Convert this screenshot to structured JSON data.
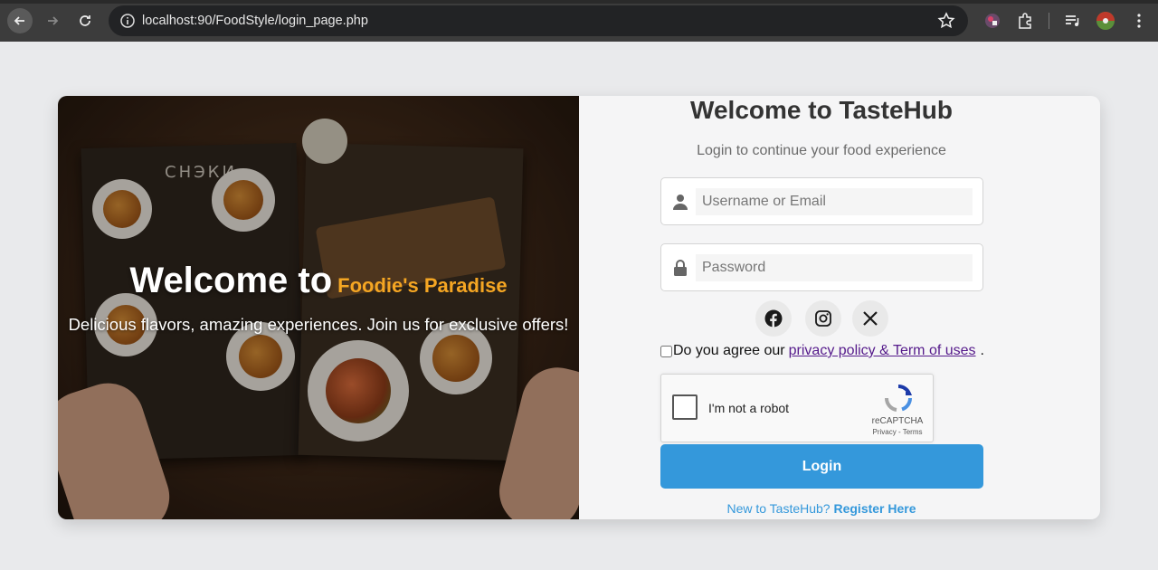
{
  "browser": {
    "url": "localhost:90/FoodStyle/login_page.php"
  },
  "hero": {
    "title_lead": "Welcome to",
    "title_accent": "Foodie's Paradise",
    "subtitle": "Delicious flavors, amazing experiences. Join us for exclusive offers!",
    "menu_heading": "СНЭКИ"
  },
  "form": {
    "title": "Welcome to TasteHub",
    "subtitle": "Login to continue your food experience",
    "username_placeholder": "Username or Email",
    "password_placeholder": "Password",
    "agree_text": "Do you agree our",
    "policy_link": "privacy policy & Term of uses",
    "period": ".",
    "login_label": "Login",
    "register_prompt": "New to TasteHub?",
    "register_link": "Register Here"
  },
  "recaptcha": {
    "label": "I'm not a robot",
    "brand": "reCAPTCHA",
    "terms": "Privacy - Terms"
  },
  "colors": {
    "accent": "#3498db",
    "hero_accent": "#f5a623",
    "link_visited": "#551a8b"
  }
}
